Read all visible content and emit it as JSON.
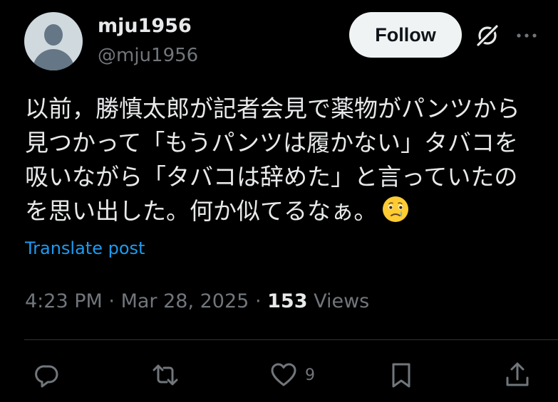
{
  "author": {
    "display_name": "mju1956",
    "handle": "@mju1956",
    "avatar_icon": "default-avatar-icon"
  },
  "header_actions": {
    "follow_label": "Follow",
    "grok_icon": "grok-icon",
    "more_icon": "more-options-icon"
  },
  "post": {
    "text_lines": [
      "以前，勝慎太郎が記者会見で薬物がパンツから",
      "見つかって「もうパンツは履かない」タバコを",
      "吸いながら「タバコは辞めた」と言っていたの",
      "を思い出した。何か似てるなぁ。"
    ],
    "emoji": "face-holding-back-tears-emoji",
    "translate_label": "Translate post"
  },
  "meta": {
    "time": "4:23 PM",
    "separator": "·",
    "date": "Mar 28, 2025",
    "views_count": "153",
    "views_label": "Views"
  },
  "actions": {
    "reply_icon": "reply-icon",
    "repost_icon": "repost-icon",
    "like_icon": "heart-icon",
    "like_count": "9",
    "bookmark_icon": "bookmark-icon",
    "share_icon": "share-icon"
  },
  "colors": {
    "background": "#000000",
    "primary_text": "#e7e9ea",
    "secondary_text": "#71767b",
    "link": "#1d9bf0",
    "follow_bg": "#eff3f4",
    "divider": "#2f3336"
  }
}
